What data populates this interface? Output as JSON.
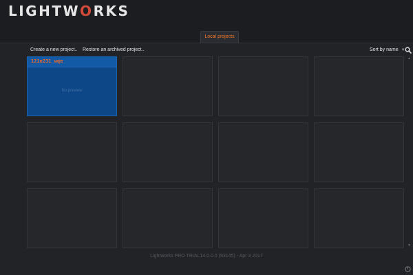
{
  "header": {
    "logo_before": "LIGHTW",
    "logo_accent": "O",
    "logo_after": "RKS",
    "tab_label": "Local projects"
  },
  "toolbar": {
    "create_label": "Create a new project..",
    "restore_label": "Restore an archived project..",
    "sort_label": "Sort by name",
    "sort_caret": "▼"
  },
  "projects": [
    {
      "title": "121e231 wqe",
      "preview_text": "No preview",
      "selected": true
    }
  ],
  "footer": {
    "version_text": "Lightworks PRO TRIAL14.0.0.0 (93145) - Apr  3 2017"
  },
  "scroll": {
    "up": "▲",
    "down": "▼"
  },
  "colors": {
    "accent_orange": "#f07a2c",
    "logo_accent": "#d14a3a",
    "selected_tile": "#0e4787",
    "background": "#212327"
  },
  "icons": {
    "search": "search-icon",
    "corner": "power-icon"
  }
}
